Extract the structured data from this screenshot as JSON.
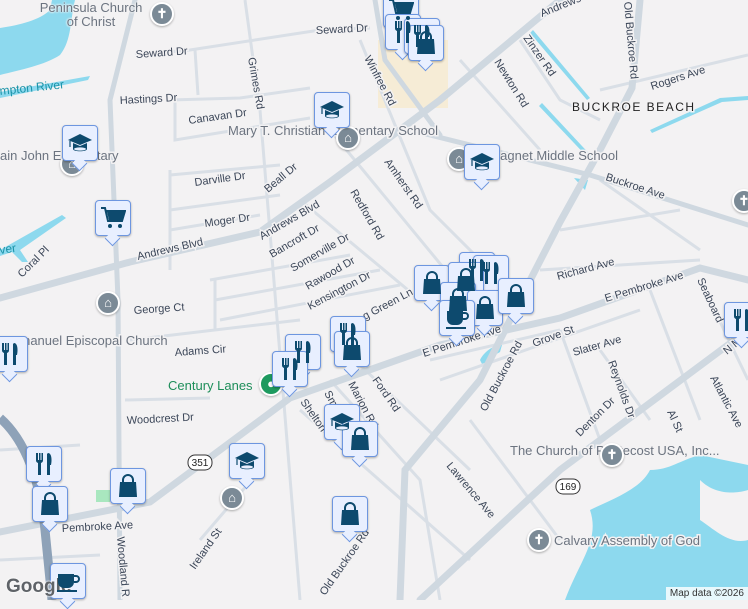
{
  "map": {
    "colors": {
      "background": "#f3f2f3",
      "water": "#8dd9ee",
      "road": "#d3dae2",
      "major_road": "#cfd8e0",
      "highway": "#8ea2b8",
      "marker_fill": "#e8efff",
      "marker_border": "#6d96e0",
      "marker_icon": "#0d4a6e",
      "poi_pin": "#7b8a96",
      "green_pin": "#1e9a5f"
    },
    "area_label": "BUCKROE BEACH",
    "water_labels": [
      "mpton River",
      "ver"
    ],
    "streets": [
      "Seward Dr",
      "Seward Dr",
      "Hastings Dr",
      "Canavan Dr",
      "Grimes Rd",
      "Winfree Rd",
      "Darville Dr",
      "Beall Dr",
      "Moger Dr",
      "Andrews Blvd",
      "Andrews Blvd",
      "Andrews Blvd",
      "Bancroft Dr",
      "Somerville Dr",
      "Redford Rd",
      "Rawood Dr",
      "Amherst Rd",
      "Kensington Dr",
      "g Green Ln",
      "Coral Pl",
      "George Ct",
      "Adams Cir",
      "Woodcrest Dr",
      "Zinzer Rd",
      "Newton Rd",
      "Old Buckroe Rd",
      "Rogers Ave",
      "Buckroe Ave",
      "Richard Ave",
      "E Pembroke Ave",
      "E Pembroke Ave",
      "Pembroke Ave",
      "Grove St",
      "Slater Ave",
      "Reynolds Dr",
      "Denton Dr",
      "Al St",
      "Atlantic Ave",
      "N M",
      "Seaboard",
      "Old Buckroe Rd",
      "Old Buckroe Rd",
      "Ford Rd",
      "Marion Rd",
      "Shelton",
      "Smith",
      "Lawrence Ave",
      "Ireland St",
      "Woodland R"
    ],
    "routes": [
      "351",
      "169"
    ],
    "places": [
      "Peninsula Church of Christ",
      "Mary T. Christian Elementary School",
      "ain John Elementary",
      "Emmanuel Episcopal Church",
      "es Magnet Middle School",
      "Century Lanes",
      "The Church of Pentecost USA, Inc...",
      "Calvary Assembly of God"
    ],
    "logo": "Google",
    "attribution": "Map data ©2026"
  }
}
